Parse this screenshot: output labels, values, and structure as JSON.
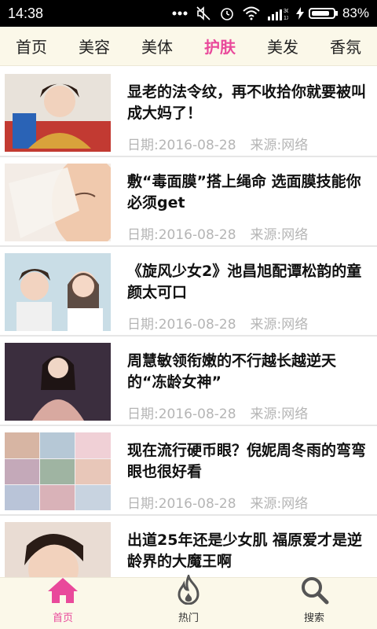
{
  "status_bar": {
    "time": "14:38",
    "icons": [
      "more-dots-icon",
      "mute-icon",
      "alarm-icon",
      "wifi-icon",
      "signal-icon",
      "charging-icon",
      "battery-icon"
    ],
    "network": "3G\n1X",
    "battery_percent": "83%",
    "battery_level": 0.83
  },
  "tabs": [
    {
      "label": "首页",
      "active": false
    },
    {
      "label": "美容",
      "active": false
    },
    {
      "label": "美体",
      "active": false
    },
    {
      "label": "护肤",
      "active": true
    },
    {
      "label": "美发",
      "active": false
    },
    {
      "label": "香氛",
      "active": false
    }
  ],
  "articles": [
    {
      "title": "显老的法令纹，再不收拾你就要被叫成大妈了！",
      "date": "日期:2016-08-28",
      "source": "来源:网络"
    },
    {
      "title": "敷“毒面膜”搭上绳命 选面膜技能你必须get",
      "date": "日期:2016-08-28",
      "source": "来源:网络"
    },
    {
      "title": "《旋风少女2》池昌旭配谭松韵的童颜太可口",
      "date": "日期:2016-08-28",
      "source": "来源:网络"
    },
    {
      "title": "周慧敏领衔嫩的不行越长越逆天的“冻龄女神”",
      "date": "日期:2016-08-28",
      "source": "来源:网络"
    },
    {
      "title": "现在流行硬币眼？倪妮周冬雨的弯弯眼也很好看",
      "date": "日期:2016-08-28",
      "source": "来源:网络"
    },
    {
      "title": "出道25年还是少女肌 福原爱才是逆龄界的大魔王啊",
      "date": "",
      "source": ""
    }
  ],
  "bottom_nav": [
    {
      "label": "首页",
      "icon": "home-icon",
      "active": true
    },
    {
      "label": "热门",
      "icon": "fire-icon",
      "active": false
    },
    {
      "label": "搜索",
      "icon": "search-icon",
      "active": false
    }
  ],
  "colors": {
    "accent": "#e9499b",
    "bar_bg": "#fbf8e9",
    "meta_text": "#b5b5b5"
  }
}
